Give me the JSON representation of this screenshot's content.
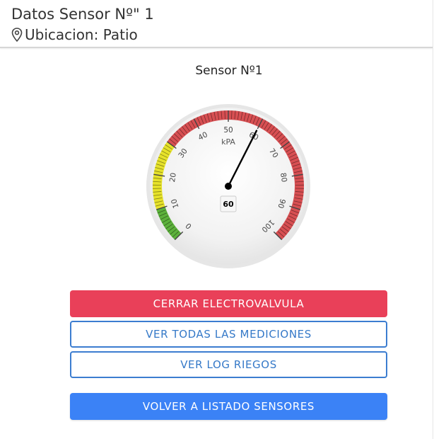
{
  "header": {
    "title": "Datos Sensor Nº\" 1",
    "location": "Ubicacion: Patio"
  },
  "sensor": {
    "title": "Sensor Nº1"
  },
  "gauge": {
    "unit": "kPA",
    "value": 60,
    "min": 0,
    "max": 100,
    "ticks": [
      "0",
      "10",
      "20",
      "30",
      "40",
      "50",
      "60",
      "70",
      "80",
      "90",
      "100"
    ],
    "zones": [
      {
        "from": 0,
        "to": 10,
        "color": "#5cb13b"
      },
      {
        "from": 10,
        "to": 30,
        "color": "#e6e22a"
      },
      {
        "from": 30,
        "to": 100,
        "color": "#d74f52"
      }
    ]
  },
  "buttons": {
    "close_valve": "CERRAR ELECTROVALVULA",
    "view_measurements": "VER TODAS LAS MEDICIONES",
    "view_log": "VER LOG RIEGOS",
    "back": "VOLVER A LISTADO SENSORES"
  },
  "colors": {
    "danger": "#e94059",
    "outline": "#3c7dd0",
    "primary": "#3b82f6"
  }
}
